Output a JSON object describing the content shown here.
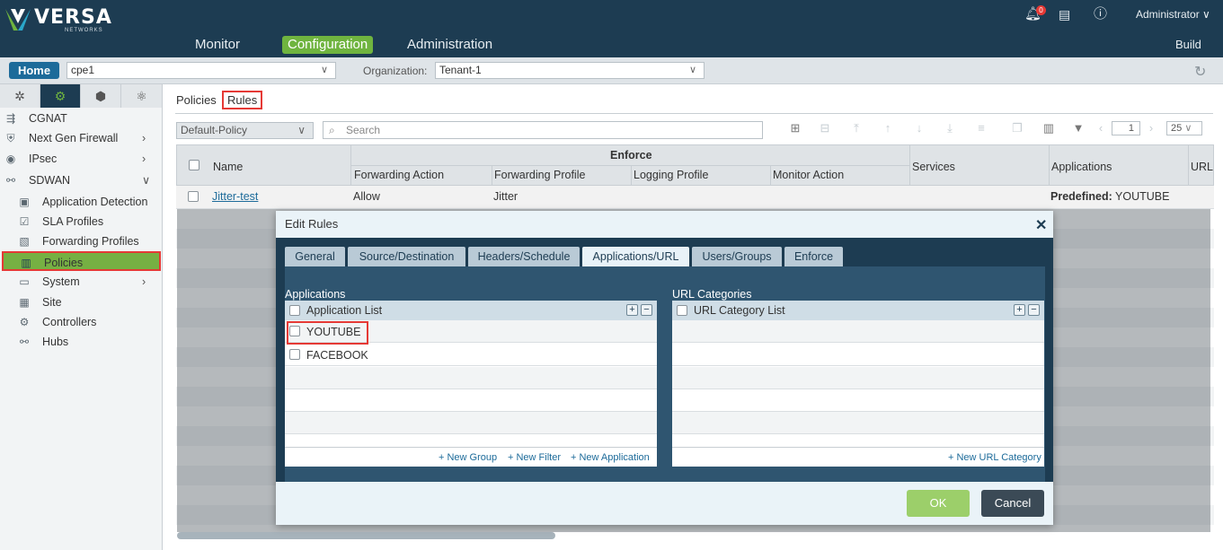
{
  "header": {
    "logo_word": "VERSA",
    "logo_sub": "NETWORKS",
    "nav": [
      "Monitor",
      "Configuration",
      "Administration"
    ],
    "active_nav": "Configuration",
    "notification_count": "0",
    "user": "Administrator",
    "build": "Build"
  },
  "subbar": {
    "home": "Home",
    "device": "cpe1",
    "org_label": "Organization:",
    "org": "Tenant-1"
  },
  "sidebar": {
    "items": [
      {
        "label": "CGNAT"
      },
      {
        "label": "Next Gen Firewall"
      },
      {
        "label": "IPsec"
      },
      {
        "label": "SDWAN"
      },
      {
        "label": "Application Detection"
      },
      {
        "label": "SLA Profiles"
      },
      {
        "label": "Forwarding Profiles"
      },
      {
        "label": "Policies"
      },
      {
        "label": "System"
      },
      {
        "label": "Site"
      },
      {
        "label": "Controllers"
      },
      {
        "label": "Hubs"
      }
    ]
  },
  "content": {
    "tabs": [
      "Policies",
      "Rules"
    ],
    "policy_select": "Default-Policy",
    "search_placeholder": "Search",
    "page": "1",
    "page_size": "25",
    "columns": {
      "name": "Name",
      "enforce": "Enforce",
      "forwarding_action": "Forwarding Action",
      "forwarding_profile": "Forwarding Profile",
      "logging_profile": "Logging Profile",
      "monitor_action": "Monitor Action",
      "services": "Services",
      "applications": "Applications",
      "url": "URL"
    },
    "rows": [
      {
        "name": "Jitter-test",
        "forwarding_action": "Allow",
        "forwarding_profile": "Jitter",
        "applications_prefix": "Predefined:",
        "applications": "YOUTUBE"
      }
    ]
  },
  "modal": {
    "title": "Edit Rules",
    "tabs": [
      "General",
      "Source/Destination",
      "Headers/Schedule",
      "Applications/URL",
      "Users/Groups",
      "Enforce"
    ],
    "active_tab": "Applications/URL",
    "applications": {
      "title": "Applications",
      "list_header": "Application List",
      "items": [
        "YOUTUBE",
        "FACEBOOK"
      ],
      "links": [
        "+ New Group",
        "+ New Filter",
        "+ New Application"
      ]
    },
    "url_categories": {
      "title": "URL Categories",
      "list_header": "URL Category List",
      "items": [],
      "links": [
        "+ New URL Category"
      ]
    },
    "ok": "OK",
    "cancel": "Cancel"
  }
}
